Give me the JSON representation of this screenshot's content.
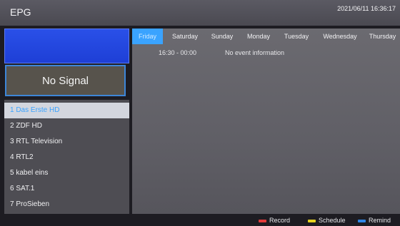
{
  "header": {
    "title": "EPG",
    "datetime": "2021/06/11 16:36:17"
  },
  "preview": {
    "status": "No Signal"
  },
  "channels": [
    {
      "label": "1 Das Erste HD",
      "selected": true
    },
    {
      "label": "2 ZDF HD"
    },
    {
      "label": "3 RTL Television"
    },
    {
      "label": "4 RTL2"
    },
    {
      "label": "5 kabel eins"
    },
    {
      "label": "6 SAT.1"
    },
    {
      "label": "7 ProSieben"
    }
  ],
  "days": [
    {
      "label": "Friday",
      "active": true
    },
    {
      "label": "Saturday"
    },
    {
      "label": "Sunday"
    },
    {
      "label": "Monday"
    },
    {
      "label": "Tuesday"
    },
    {
      "label": "Wednesday"
    },
    {
      "label": "Thursday"
    }
  ],
  "event": {
    "time": "16:30 - 00:00",
    "info": "No event information"
  },
  "legend": {
    "record": {
      "label": "Record",
      "color": "#e23a3a"
    },
    "schedule": {
      "label": "Schedule",
      "color": "#e6d21f"
    },
    "remind": {
      "label": "Remind",
      "color": "#2f86e6"
    }
  }
}
